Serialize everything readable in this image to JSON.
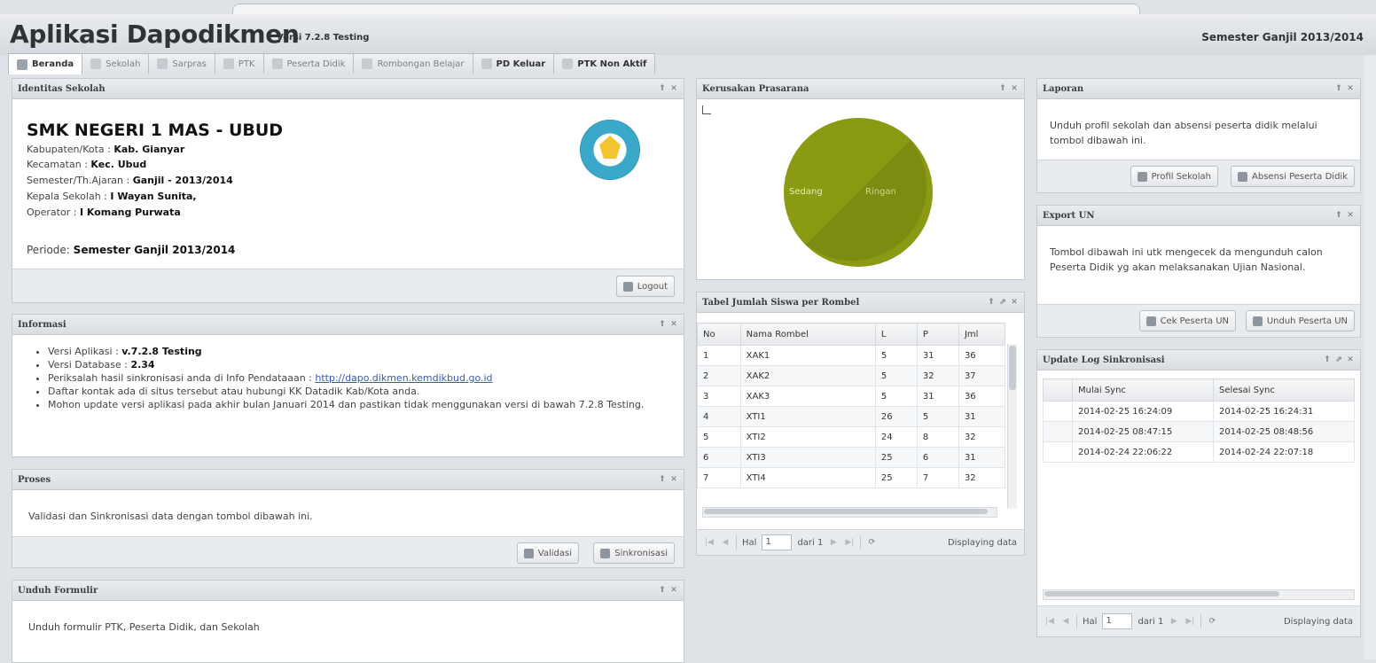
{
  "app": {
    "title": "Aplikasi Dapodikmen",
    "version": "Versi 7.2.8 Testing",
    "semester": "Semester Ganjil 2013/2014"
  },
  "tabs": [
    {
      "label": "Beranda",
      "icon": "home-icon",
      "active": true
    },
    {
      "label": "Sekolah",
      "icon": "school-icon"
    },
    {
      "label": "Sarpras",
      "icon": "building-icon"
    },
    {
      "label": "PTK",
      "icon": "person-icon"
    },
    {
      "label": "Peserta Didik",
      "icon": "student-icon"
    },
    {
      "label": "Rombongan Belajar",
      "icon": "group-icon"
    },
    {
      "label": "PD Keluar",
      "icon": "exit-icon"
    },
    {
      "label": "PTK Non Aktif",
      "icon": "person-off-icon"
    }
  ],
  "identitas": {
    "title": "Identitas Sekolah",
    "school_name": "SMK NEGERI 1 MAS - UBUD",
    "kabupaten_label": "Kabupaten/Kota :",
    "kabupaten": "Kab. Gianyar",
    "kecamatan_label": "Kecamatan :",
    "kecamatan": "Kec. Ubud",
    "semester_label": "Semester/Th.Ajaran :",
    "semester": "Ganjil - 2013/2014",
    "kepala_label": "Kepala Sekolah :",
    "kepala": "I Wayan Sunita,",
    "operator_label": "Operator :",
    "operator": "I Komang Purwata",
    "periode_label": "Periode:",
    "periode": "Semester Ganjil 2013/2014",
    "logout": "Logout"
  },
  "informasi": {
    "title": "Informasi",
    "versi_aplikasi_label": "Versi Aplikasi :",
    "versi_aplikasi": "v.7.2.8 Testing",
    "versi_db_label": "Versi Database :",
    "versi_db": "2.34",
    "periksa_text": "Periksalah hasil sinkronisasi anda di Info Pendataaan :",
    "periksa_link": "http://dapo.dikmen.kemdikbud.go.id",
    "kontak_text": "Daftar kontak ada di situs tersebut atau hubungi KK Datadik Kab/Kota anda.",
    "update_text": "Mohon update versi aplikasi pada akhir bulan Januari 2014 dan pastikan tidak menggunakan versi di bawah 7.2.8 Testing."
  },
  "proses": {
    "title": "Proses",
    "text": "Validasi dan Sinkronisasi data dengan tombol dibawah ini.",
    "validasi": "Validasi",
    "sinkronisasi": "Sinkronisasi"
  },
  "unduh": {
    "title": "Unduh Formulir",
    "text": "Unduh formulir PTK, Peserta Didik, dan Sekolah"
  },
  "kerusakan": {
    "title": "Kerusakan Prasarana",
    "label_a": "Sedang",
    "label_b": "Ringan",
    "colors": {
      "a": "#8a9a12",
      "b": "#7d8c10"
    }
  },
  "rombel": {
    "title": "Tabel Jumlah Siswa per Rombel",
    "headers": [
      "No",
      "Nama Rombel",
      "L",
      "P",
      "Jml"
    ],
    "rows": [
      [
        "1",
        "XAK1",
        "5",
        "31",
        "36"
      ],
      [
        "2",
        "XAK2",
        "5",
        "32",
        "37"
      ],
      [
        "3",
        "XAK3",
        "5",
        "31",
        "36"
      ],
      [
        "4",
        "XTI1",
        "26",
        "5",
        "31"
      ],
      [
        "5",
        "XTI2",
        "24",
        "8",
        "32"
      ],
      [
        "6",
        "XTI3",
        "25",
        "6",
        "31"
      ],
      [
        "7",
        "XTI4",
        "25",
        "7",
        "32"
      ]
    ],
    "pager": {
      "hal": "Hal",
      "page": "1",
      "dari": "dari 1",
      "displaying": "Displaying data"
    }
  },
  "laporan": {
    "title": "Laporan",
    "text": "Unduh profil sekolah dan absensi peserta didik melalui tombol dibawah ini.",
    "profil": "Profil Sekolah",
    "absensi": "Absensi Peserta Didik"
  },
  "export_un": {
    "title": "Export UN",
    "text": "Tombol dibawah ini utk mengecek da mengunduh calon Peserta Didik yg akan melaksanakan Ujian Nasional.",
    "cek": "Cek Peserta UN",
    "unduh": "Unduh Peserta UN"
  },
  "synclog": {
    "title": "Update Log Sinkronisasi",
    "headers": [
      "Mulai Sync",
      "Selesai Sync"
    ],
    "rows": [
      [
        "2014-02-25 16:24:09",
        "2014-02-25 16:24:31"
      ],
      [
        "2014-02-25 08:47:15",
        "2014-02-25 08:48:56"
      ],
      [
        "2014-02-24 22:06:22",
        "2014-02-24 22:07:18"
      ]
    ],
    "pager": {
      "hal": "Hal",
      "page": "1",
      "dari": "dari 1",
      "displaying": "Displaying data"
    }
  }
}
